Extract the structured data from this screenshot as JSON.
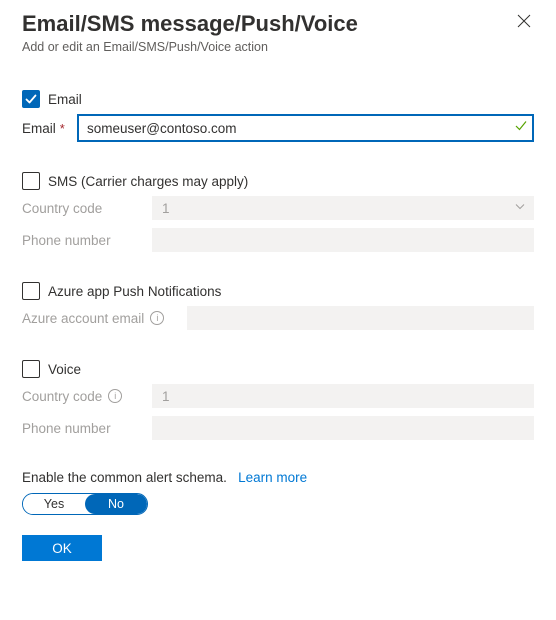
{
  "header": {
    "title": "Email/SMS message/Push/Voice",
    "subtitle": "Add or edit an Email/SMS/Push/Voice action"
  },
  "email": {
    "checkbox_label": "Email",
    "field_label": "Email",
    "required_mark": "*",
    "value": "someuser@contoso.com"
  },
  "sms": {
    "checkbox_label": "SMS (Carrier charges may apply)",
    "country_label": "Country code",
    "country_value": "1",
    "phone_label": "Phone number"
  },
  "push": {
    "checkbox_label": "Azure app Push Notifications",
    "email_label": "Azure account email"
  },
  "voice": {
    "checkbox_label": "Voice",
    "country_label": "Country code",
    "country_value": "1",
    "phone_label": "Phone number"
  },
  "schema": {
    "text": "Enable the common alert schema.",
    "link": "Learn more",
    "yes": "Yes",
    "no": "No"
  },
  "footer": {
    "ok": "OK"
  }
}
